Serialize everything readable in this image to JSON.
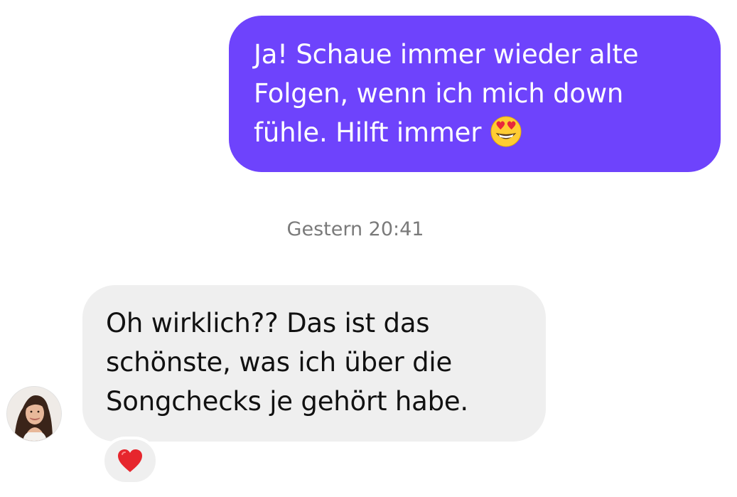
{
  "messages": {
    "outgoing": {
      "lines": [
        "Ja! Schaue immer wieder alte",
        "Folgen, wenn ich mich down",
        "fühle. Hilft immer"
      ],
      "emoji": "smiling-face-with-heart-eyes",
      "bubble_color": "#6e43fc"
    },
    "timestamp": "Gestern 20:41",
    "incoming": {
      "lines": [
        "Oh wirklich?? Das ist das",
        "schönste, was ich über die",
        "Songchecks je gehört habe."
      ],
      "bubble_color": "#efefef",
      "reaction": "red-heart"
    }
  }
}
